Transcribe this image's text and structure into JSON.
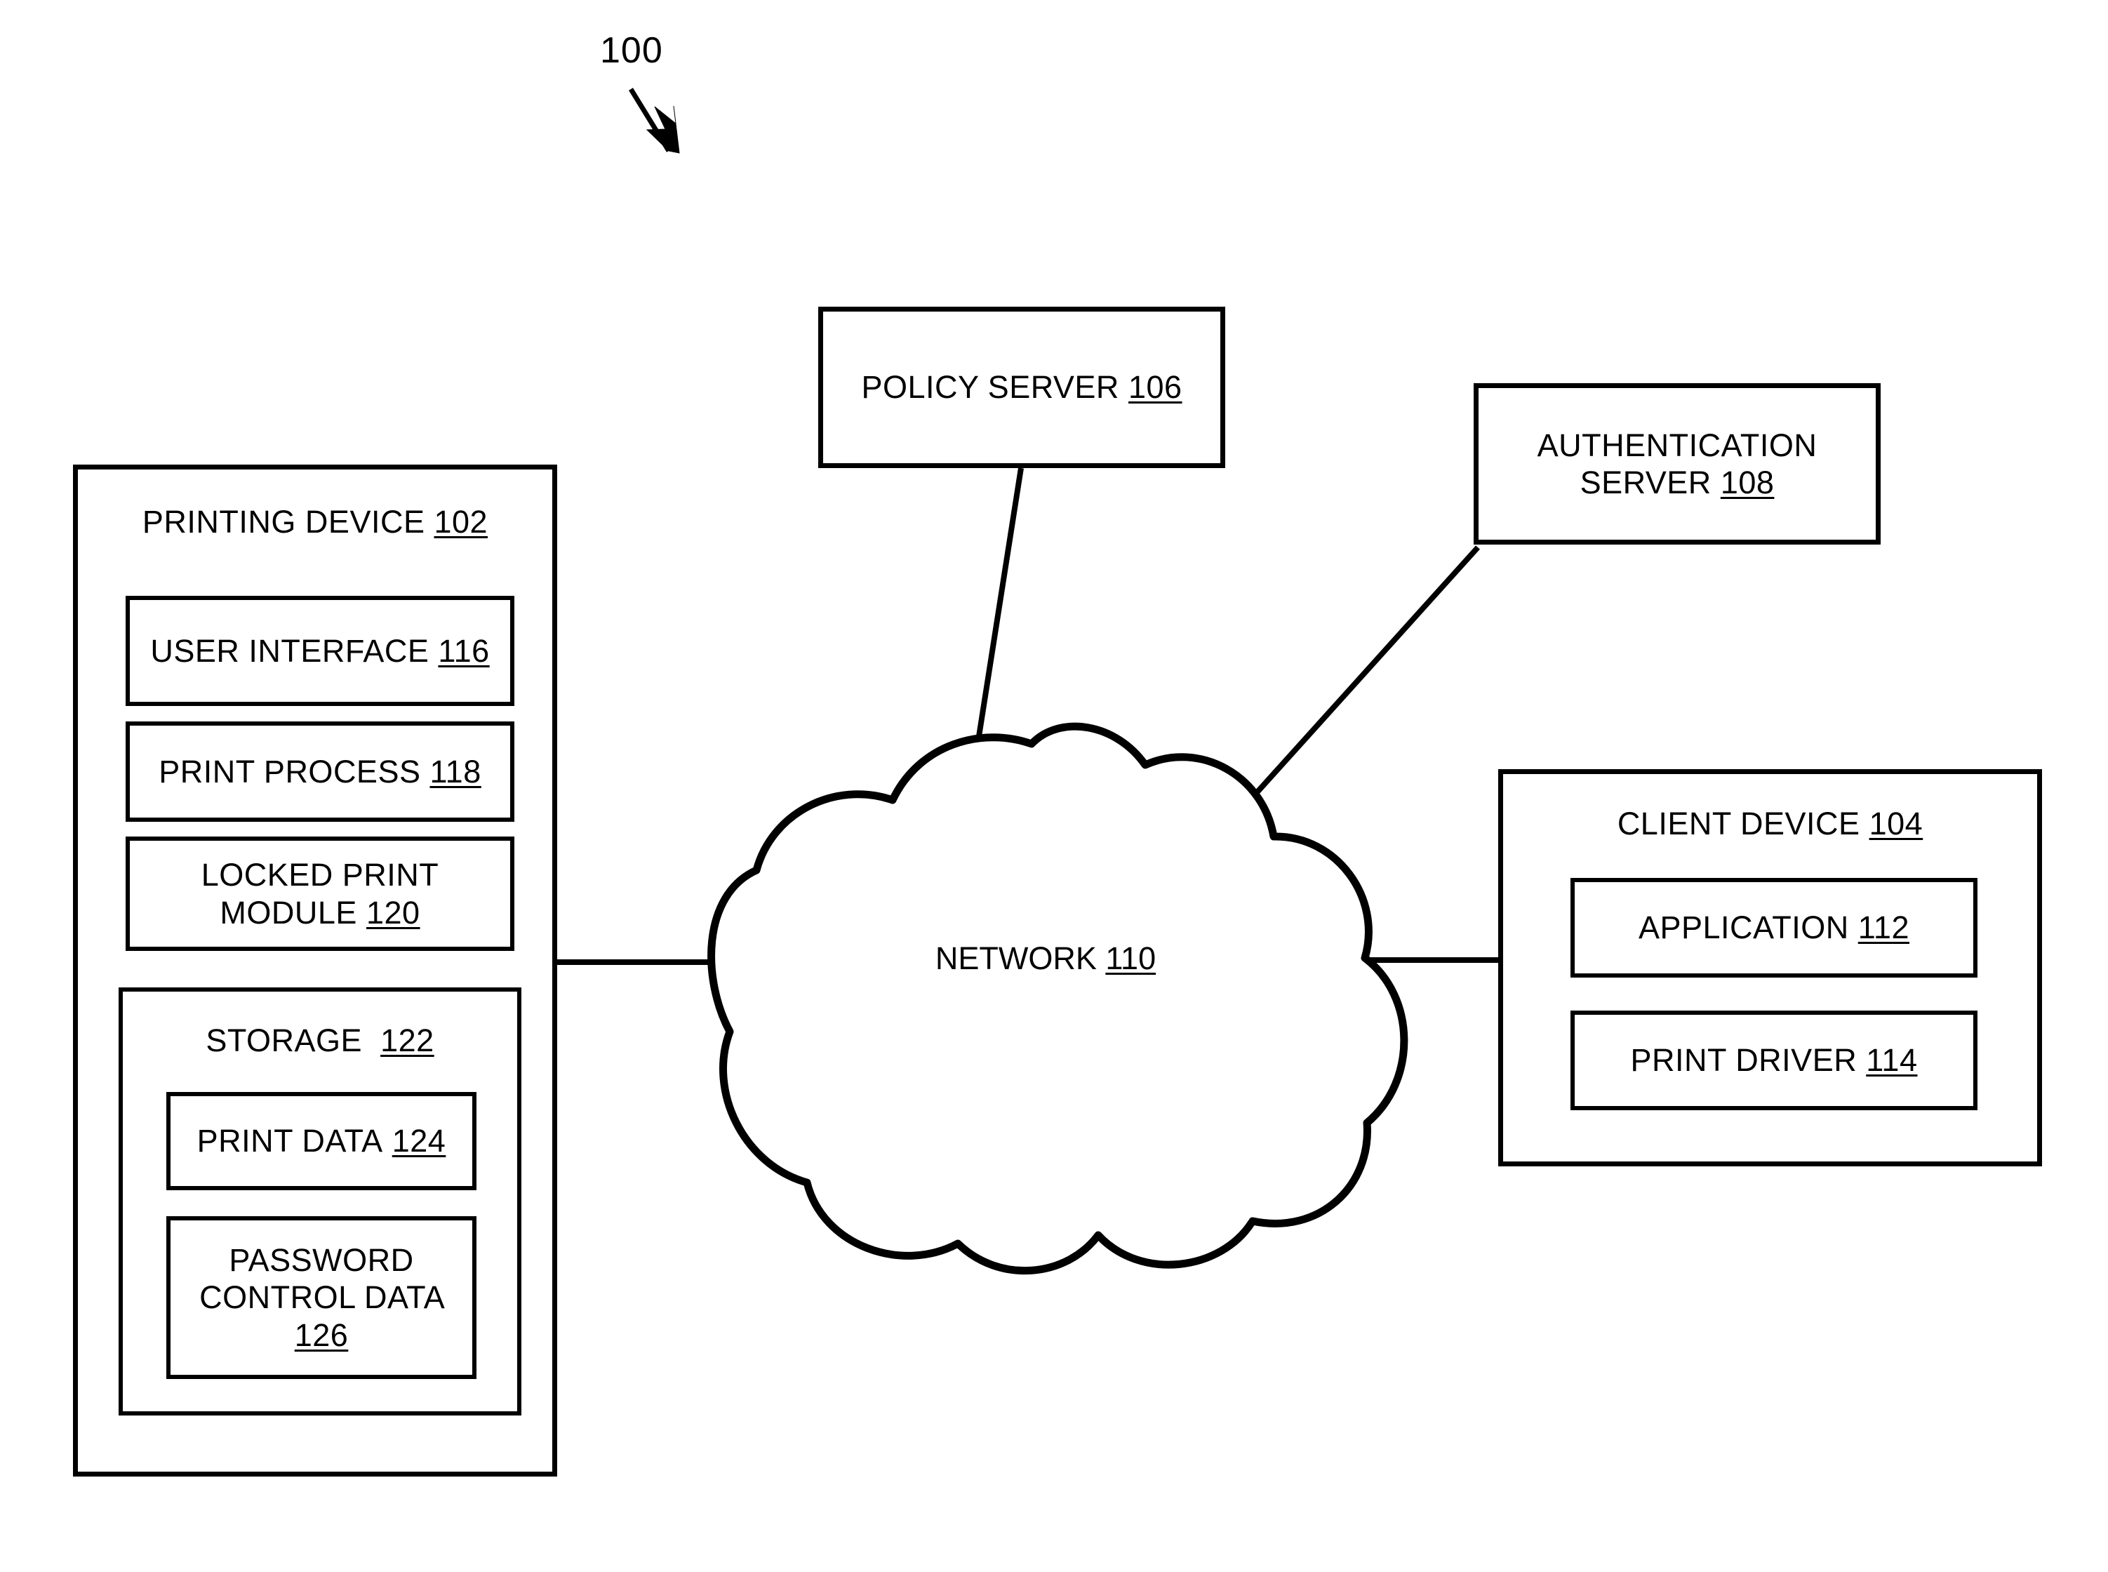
{
  "figure": {
    "number": "100",
    "callout_icon": "down-right-arrow"
  },
  "nodes": {
    "printing_device": {
      "title": "PRINTING DEVICE",
      "ref": "102",
      "children": {
        "user_interface": {
          "title": "USER INTERFACE",
          "ref": "116"
        },
        "print_process": {
          "title": "PRINT PROCESS",
          "ref": "118"
        },
        "locked_print_module": {
          "title": "LOCKED PRINT MODULE",
          "ref": "120"
        },
        "storage": {
          "title": "STORAGE",
          "ref": "122",
          "children": {
            "print_data": {
              "title": "PRINT DATA",
              "ref": "124"
            },
            "password_control_data": {
              "title": "PASSWORD CONTROL DATA",
              "ref": "126"
            }
          }
        }
      }
    },
    "policy_server": {
      "title": "POLICY SERVER",
      "ref": "106"
    },
    "authentication_server": {
      "title": "AUTHENTICATION SERVER",
      "ref": "108"
    },
    "network": {
      "title": "NETWORK",
      "ref": "110",
      "shape": "cloud"
    },
    "client_device": {
      "title": "CLIENT DEVICE",
      "ref": "104",
      "children": {
        "application": {
          "title": "APPLICATION",
          "ref": "112"
        },
        "print_driver": {
          "title": "PRINT DRIVER",
          "ref": "114"
        }
      }
    }
  },
  "connectors": [
    {
      "from": "printing_device",
      "to": "network",
      "style": "solid-line"
    },
    {
      "from": "network",
      "to": "client_device",
      "style": "solid-line"
    },
    {
      "from": "policy_server",
      "to": "network",
      "style": "solid-line"
    },
    {
      "from": "authentication_server",
      "to": "network",
      "style": "solid-line"
    }
  ],
  "colors": {
    "stroke": "#000000",
    "background": "#ffffff"
  }
}
